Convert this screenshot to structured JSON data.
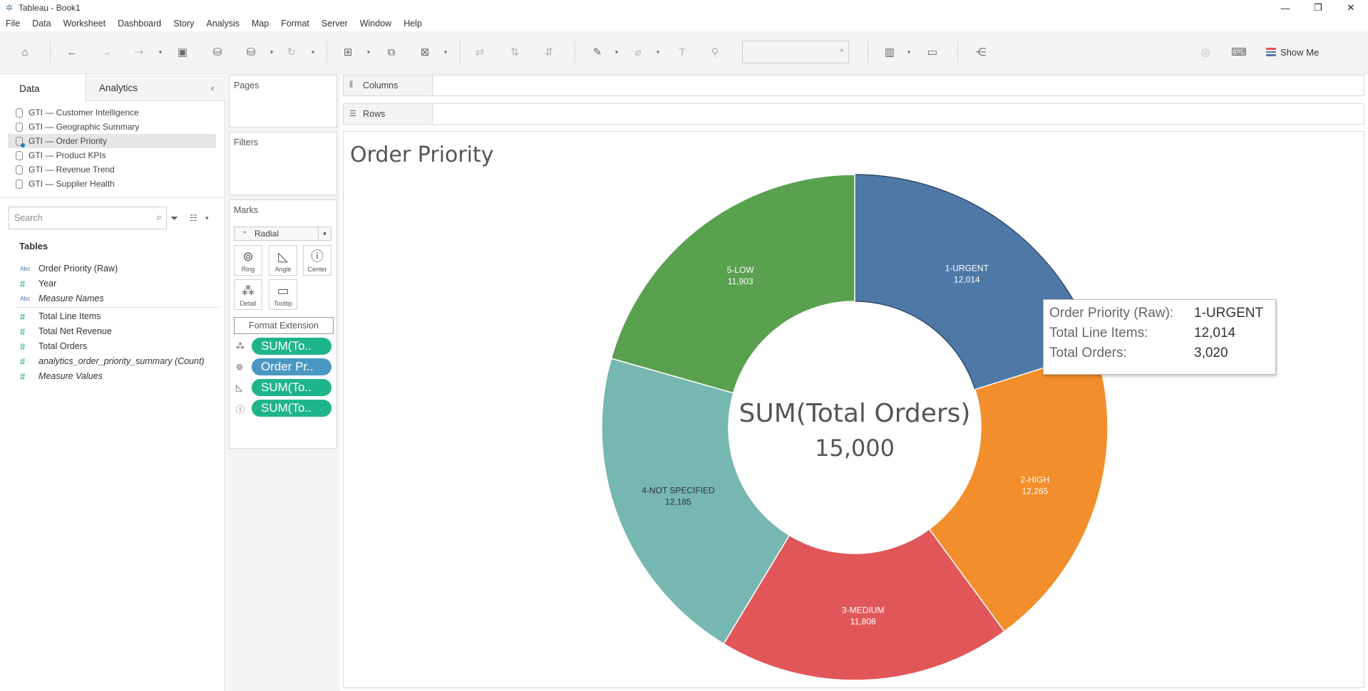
{
  "window": {
    "title": "Tableau - Book1"
  },
  "menu": [
    "File",
    "Data",
    "Worksheet",
    "Dashboard",
    "Story",
    "Analysis",
    "Map",
    "Format",
    "Server",
    "Window",
    "Help"
  ],
  "toolbar": {
    "show_me_label": "Show Me"
  },
  "side_tabs": {
    "data": "Data",
    "analytics": "Analytics"
  },
  "data_sources": [
    "GTI — Customer Intelligence",
    "GTI — Geographic Summary",
    "GTI — Order Priority",
    "GTI — Product KPIs",
    "GTI — Revenue Trend",
    "GTI — Supplier Health"
  ],
  "selected_data_source": "GTI — Order Priority",
  "search": {
    "placeholder": "Search"
  },
  "tables_heading": "Tables",
  "dimensions": [
    {
      "type": "Abc",
      "name": "Order Priority (Raw)"
    },
    {
      "type": "#",
      "name": "Year"
    },
    {
      "type": "Abc",
      "name": "Measure Names"
    }
  ],
  "measures": [
    {
      "type": "#",
      "name": "Total Line Items"
    },
    {
      "type": "#",
      "name": "Total Net Revenue"
    },
    {
      "type": "#",
      "name": "Total Orders"
    },
    {
      "type": "#",
      "name": "analytics_order_priority_summary (Count)"
    },
    {
      "type": "#",
      "name": "Measure Values"
    }
  ],
  "cards": {
    "pages": "Pages",
    "filters": "Filters",
    "marks": "Marks",
    "mark_type": "Radial",
    "mark_buttons": [
      "Ring",
      "Angle",
      "Center",
      "Detail",
      "Tooltip"
    ],
    "format_extension": "Format Extension",
    "pills": [
      "SUM(To..",
      "Order Pr..",
      "SUM(To..",
      "SUM(To.."
    ]
  },
  "shelves": {
    "columns": "Columns",
    "rows": "Rows"
  },
  "colors": {
    "1-URGENT": "#4e79a7",
    "2-HIGH": "#f28e2b",
    "3-MEDIUM": "#e15759",
    "4-NOT SPECIFIED": "#76b7b2",
    "5-LOW": "#59a14f"
  },
  "chart_data": {
    "type": "pie",
    "title": "Order Priority",
    "center_label": "SUM(Total Orders)",
    "center_value": "15,000",
    "categories": [
      "1-URGENT",
      "2-HIGH",
      "3-MEDIUM",
      "4-NOT SPECIFIED",
      "5-LOW"
    ],
    "slice_values": [
      3020,
      2970,
      2810,
      3110,
      3090
    ],
    "labels": [
      "12,014",
      "12,265",
      "11,808",
      "12,185",
      "11,903"
    ],
    "series": [
      {
        "name": "Total Line Items",
        "values": [
          12014,
          12265,
          11808,
          12185,
          11903
        ]
      }
    ]
  },
  "tooltip": {
    "rows": [
      {
        "key": "Order Priority (Raw):",
        "value": "1-URGENT"
      },
      {
        "key": "Total Line Items:",
        "value": "12,014"
      },
      {
        "key": "Total Orders:",
        "value": "3,020"
      }
    ]
  }
}
